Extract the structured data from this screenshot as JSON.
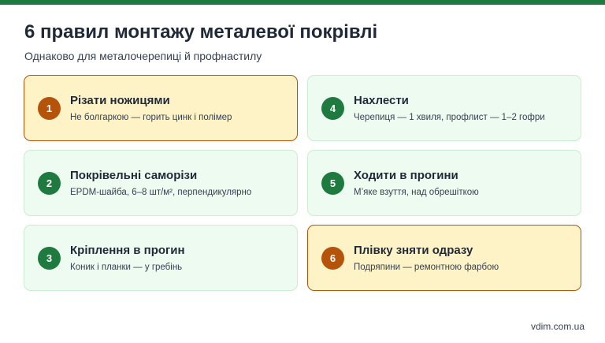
{
  "slide": {
    "title": "6 правил монтажу металевої покрівлі",
    "subtitle": "Однаково для металочерепиці й профнастилу",
    "footer": "vdim.com.ua"
  },
  "colors": {
    "accent": "#1e7a3e",
    "warning": "#b45309",
    "card_bg": "#eefbf1",
    "warning_bg": "#fef3c7"
  },
  "rules": [
    {
      "number": "1",
      "title": "Різати ножицями",
      "desc": "Не болгаркою — горить цинк і полімер",
      "highlight": true
    },
    {
      "number": "2",
      "title": "Покрівельні саморізи",
      "desc": "EPDM-шайба, 6–8 шт/м², перпендикулярно",
      "highlight": false
    },
    {
      "number": "3",
      "title": "Кріплення в прогин",
      "desc": "Коник і планки — у гребінь",
      "highlight": false
    },
    {
      "number": "4",
      "title": "Нахлести",
      "desc": "Черепиця — 1 хвиля, профлист — 1–2 гофри",
      "highlight": false
    },
    {
      "number": "5",
      "title": "Ходити в прогини",
      "desc": "М’яке взуття, над обрешіткою",
      "highlight": false
    },
    {
      "number": "6",
      "title": "Плівку зняти одразу",
      "desc": "Подряпини — ремонтною фарбою",
      "highlight": true
    }
  ]
}
